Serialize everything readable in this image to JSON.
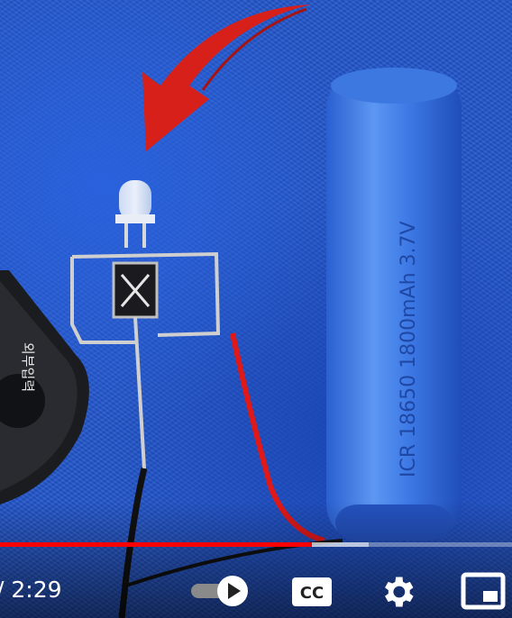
{
  "video": {
    "printed_labels": {
      "remote_label": "외부입력",
      "battery_label": "ICR 18650 1800mAh 3.7V"
    }
  },
  "controls": {
    "time_display": "/ 2:29",
    "progress": {
      "played_fraction": 0.61,
      "buffered_fraction": 0.72
    },
    "autoplay_icon": "autoplay-toggle-icon",
    "cc_label": "CC",
    "settings_icon": "gear-icon",
    "miniplayer_icon": "miniplayer-icon"
  },
  "colors": {
    "progress_played": "#ff0000",
    "background": "#2356cc"
  }
}
